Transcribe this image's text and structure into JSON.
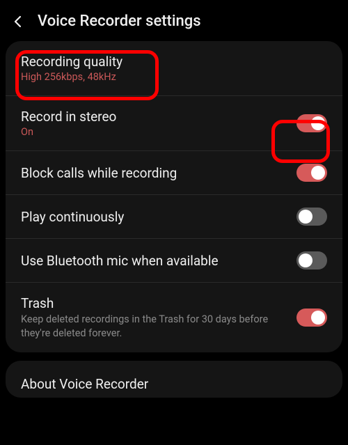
{
  "header": {
    "title": "Voice Recorder settings"
  },
  "settings": {
    "recording_quality": {
      "title": "Recording quality",
      "sub": "High 256kbps, 48kHz"
    },
    "record_stereo": {
      "title": "Record in stereo",
      "sub": "On",
      "on": true
    },
    "block_calls": {
      "title": "Block calls while recording",
      "on": true
    },
    "play_continuously": {
      "title": "Play continuously",
      "on": false
    },
    "use_bluetooth": {
      "title": "Use Bluetooth mic when available",
      "on": false
    },
    "trash": {
      "title": "Trash",
      "sub": "Keep deleted recordings in the Trash for 30 days before they're deleted forever.",
      "on": true
    }
  },
  "about": {
    "title": "About Voice Recorder"
  }
}
